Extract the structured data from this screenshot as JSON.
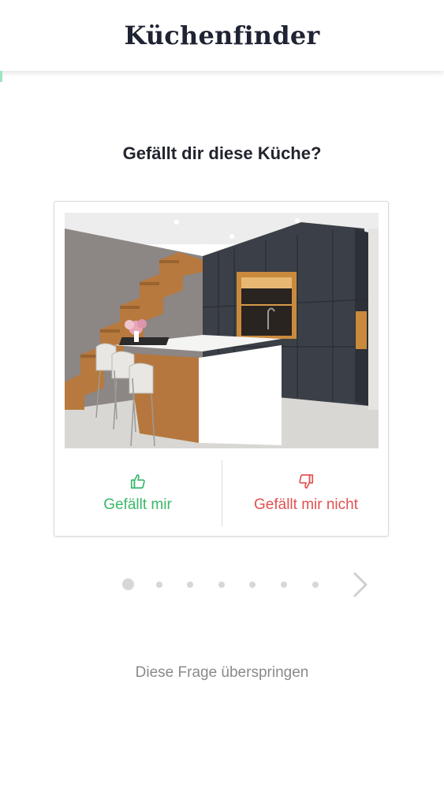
{
  "header": {
    "title": "Küchenfinder"
  },
  "question": "Gefällt dir diese Küche?",
  "card": {
    "image": "kitchen-photo",
    "like_label": "Gefällt mir",
    "dislike_label": "Gefällt mir nicht",
    "like_icon": "thumbs-up-icon",
    "dislike_icon": "thumbs-down-icon"
  },
  "pagination": {
    "current": 1,
    "total": 7,
    "next_icon": "chevron-right-icon"
  },
  "skip_label": "Diese Frage überspringen",
  "colors": {
    "like": "#38b86a",
    "dislike": "#e25050",
    "title": "#1f2333"
  }
}
